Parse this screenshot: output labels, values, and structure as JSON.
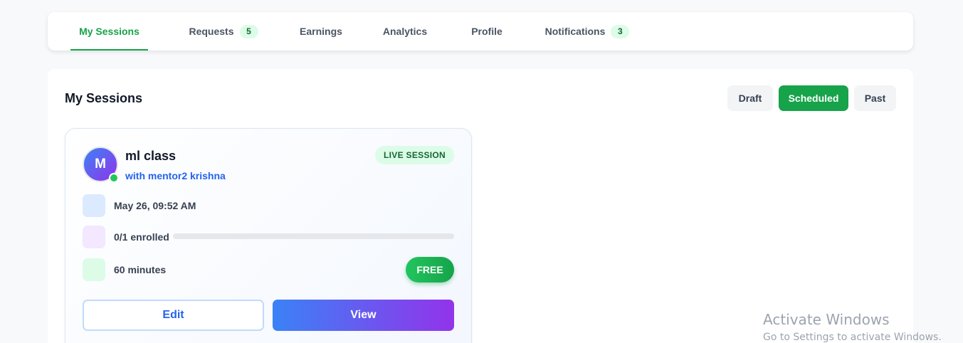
{
  "tabs": [
    {
      "label": "My Sessions",
      "count": null
    },
    {
      "label": "Requests",
      "count": "5"
    },
    {
      "label": "Earnings",
      "count": null
    },
    {
      "label": "Analytics",
      "count": null
    },
    {
      "label": "Profile",
      "count": null
    },
    {
      "label": "Notifications",
      "count": "3"
    }
  ],
  "active_tab": "My Sessions",
  "panel": {
    "title": "My Sessions",
    "filters": [
      "Draft",
      "Scheduled",
      "Past"
    ],
    "active_filter": "Scheduled"
  },
  "session": {
    "avatar_initial": "M",
    "title": "ml class",
    "mentor": "with mentor2 krishna",
    "status_badge": "LIVE SESSION",
    "datetime": "May 26, 09:52 AM",
    "enrolled": "0/1 enrolled",
    "enrollment_progress": 0,
    "duration": "60 minutes",
    "price": "FREE",
    "edit_label": "Edit",
    "view_label": "View"
  },
  "watermark": {
    "title": "Activate Windows",
    "subtitle": "Go to Settings to activate Windows."
  },
  "colors": {
    "accent_green": "#16a34a",
    "accent_blue": "#2563eb",
    "accent_purple": "#9333ea"
  },
  "icons": [
    "calendar-icon",
    "users-icon",
    "clock-icon",
    "online-status-icon"
  ]
}
